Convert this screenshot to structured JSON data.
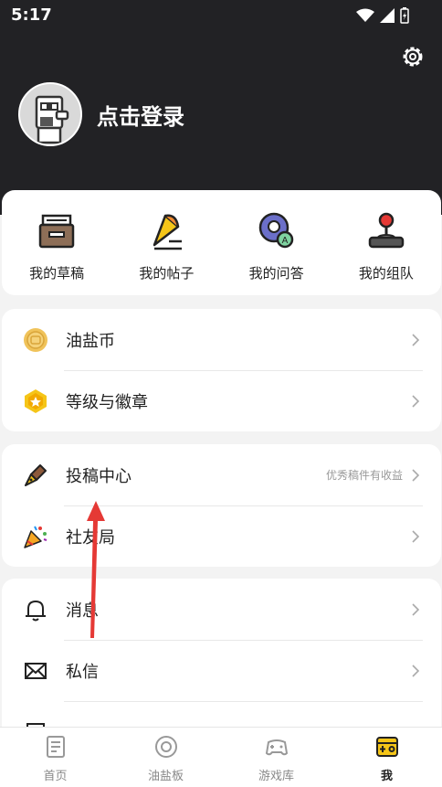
{
  "status_bar": {
    "time": "5:17"
  },
  "header": {
    "login_text": "点击登录"
  },
  "quick_actions": [
    {
      "label": "我的草稿",
      "icon": "drafts-box-icon"
    },
    {
      "label": "我的帖子",
      "icon": "posts-megaphone-icon"
    },
    {
      "label": "我的问答",
      "icon": "qa-bubble-icon"
    },
    {
      "label": "我的组队",
      "icon": "team-joystick-icon"
    }
  ],
  "group1": [
    {
      "label": "油盐币",
      "icon": "coin-icon"
    },
    {
      "label": "等级与徽章",
      "icon": "badge-icon"
    }
  ],
  "group2": [
    {
      "label": "投稿中心",
      "hint": "优秀稿件有收益",
      "icon": "pen-nib-icon"
    },
    {
      "label": "社友局",
      "icon": "party-popper-icon"
    }
  ],
  "group3": [
    {
      "label": "消息",
      "icon": "bell-icon"
    },
    {
      "label": "私信",
      "icon": "mail-icon"
    }
  ],
  "bottom_nav": [
    {
      "label": "首页",
      "icon": "home-doc-icon"
    },
    {
      "label": "油盐板",
      "icon": "board-circle-icon"
    },
    {
      "label": "游戏库",
      "icon": "gamepad-icon"
    },
    {
      "label": "我",
      "icon": "me-gamepad-icon",
      "active": true
    }
  ],
  "colors": {
    "header_bg": "#222225",
    "accent_yellow": "#f5c518",
    "red": "#e53935"
  }
}
